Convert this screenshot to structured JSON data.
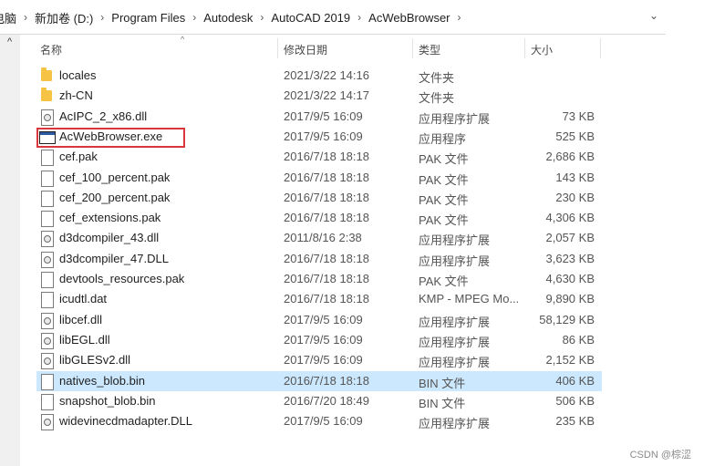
{
  "breadcrumb": [
    "电脑",
    "新加卷 (D:)",
    "Program Files",
    "Autodesk",
    "AutoCAD 2019",
    "AcWebBrowser"
  ],
  "columns": {
    "name": "名称",
    "date": "修改日期",
    "type": "类型",
    "size": "大小"
  },
  "files": [
    {
      "name": "locales",
      "date": "2021/3/22 14:16",
      "type": "文件夹",
      "size": "",
      "icon": "folder-icon"
    },
    {
      "name": "zh-CN",
      "date": "2021/3/22 14:17",
      "type": "文件夹",
      "size": "",
      "icon": "folder-icon"
    },
    {
      "name": "AcIPC_2_x86.dll",
      "date": "2017/9/5 16:09",
      "type": "应用程序扩展",
      "size": "73 KB",
      "icon": "dll-icon"
    },
    {
      "name": "AcWebBrowser.exe",
      "date": "2017/9/5 16:09",
      "type": "应用程序",
      "size": "525 KB",
      "icon": "exe-icon"
    },
    {
      "name": "cef.pak",
      "date": "2016/7/18 18:18",
      "type": "PAK 文件",
      "size": "2,686 KB",
      "icon": "file-icon"
    },
    {
      "name": "cef_100_percent.pak",
      "date": "2016/7/18 18:18",
      "type": "PAK 文件",
      "size": "143 KB",
      "icon": "file-icon"
    },
    {
      "name": "cef_200_percent.pak",
      "date": "2016/7/18 18:18",
      "type": "PAK 文件",
      "size": "230 KB",
      "icon": "file-icon"
    },
    {
      "name": "cef_extensions.pak",
      "date": "2016/7/18 18:18",
      "type": "PAK 文件",
      "size": "4,306 KB",
      "icon": "file-icon"
    },
    {
      "name": "d3dcompiler_43.dll",
      "date": "2011/8/16 2:38",
      "type": "应用程序扩展",
      "size": "2,057 KB",
      "icon": "dll-icon"
    },
    {
      "name": "d3dcompiler_47.DLL",
      "date": "2016/7/18 18:18",
      "type": "应用程序扩展",
      "size": "3,623 KB",
      "icon": "dll-icon"
    },
    {
      "name": "devtools_resources.pak",
      "date": "2016/7/18 18:18",
      "type": "PAK 文件",
      "size": "4,630 KB",
      "icon": "file-icon"
    },
    {
      "name": "icudtl.dat",
      "date": "2016/7/18 18:18",
      "type": "KMP - MPEG Mo...",
      "size": "9,890 KB",
      "icon": "file-icon"
    },
    {
      "name": "libcef.dll",
      "date": "2017/9/5 16:09",
      "type": "应用程序扩展",
      "size": "58,129 KB",
      "icon": "dll-icon"
    },
    {
      "name": "libEGL.dll",
      "date": "2017/9/5 16:09",
      "type": "应用程序扩展",
      "size": "86 KB",
      "icon": "dll-icon"
    },
    {
      "name": "libGLESv2.dll",
      "date": "2017/9/5 16:09",
      "type": "应用程序扩展",
      "size": "2,152 KB",
      "icon": "dll-icon"
    },
    {
      "name": "natives_blob.bin",
      "date": "2016/7/18 18:18",
      "type": "BIN 文件",
      "size": "406 KB",
      "icon": "file-icon",
      "selected": true
    },
    {
      "name": "snapshot_blob.bin",
      "date": "2016/7/20 18:49",
      "type": "BIN 文件",
      "size": "506 KB",
      "icon": "file-icon"
    },
    {
      "name": "widevinecdmadapter.DLL",
      "date": "2017/9/5 16:09",
      "type": "应用程序扩展",
      "size": "235 KB",
      "icon": "dll-icon"
    }
  ],
  "watermark": "CSDN @棕涩"
}
